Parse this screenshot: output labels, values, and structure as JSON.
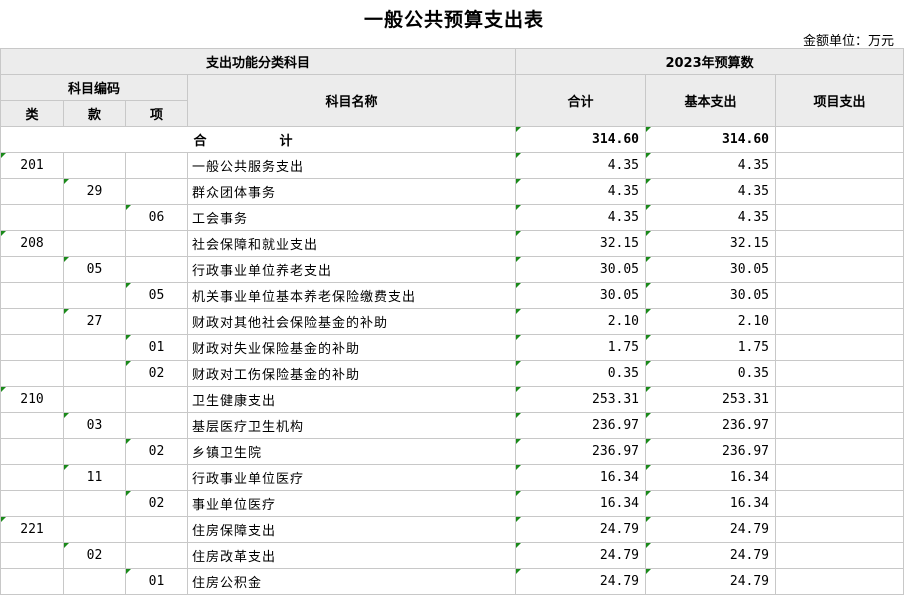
{
  "title": "一般公共预算支出表",
  "unit": "金额单位：万元",
  "header": {
    "group_left": "支出功能分类科目",
    "group_right": "2023年预算数",
    "code_group": "科目编码",
    "lei": "类",
    "kuan": "款",
    "xiang": "项",
    "name": "科目名称",
    "total": "合计",
    "basic": "基本支出",
    "project": "项目支出"
  },
  "total_row": {
    "label": "合　计",
    "total": "314.60",
    "basic": "314.60",
    "project": ""
  },
  "rows": [
    {
      "lei": "201",
      "kuan": "",
      "xiang": "",
      "name": "一般公共服务支出",
      "total": "4.35",
      "basic": "4.35",
      "project": ""
    },
    {
      "lei": "",
      "kuan": "29",
      "xiang": "",
      "name": "群众团体事务",
      "total": "4.35",
      "basic": "4.35",
      "project": ""
    },
    {
      "lei": "",
      "kuan": "",
      "xiang": "06",
      "name": "工会事务",
      "total": "4.35",
      "basic": "4.35",
      "project": ""
    },
    {
      "lei": "208",
      "kuan": "",
      "xiang": "",
      "name": "社会保障和就业支出",
      "total": "32.15",
      "basic": "32.15",
      "project": ""
    },
    {
      "lei": "",
      "kuan": "05",
      "xiang": "",
      "name": "行政事业单位养老支出",
      "total": "30.05",
      "basic": "30.05",
      "project": ""
    },
    {
      "lei": "",
      "kuan": "",
      "xiang": "05",
      "name": "机关事业单位基本养老保险缴费支出",
      "total": "30.05",
      "basic": "30.05",
      "project": ""
    },
    {
      "lei": "",
      "kuan": "27",
      "xiang": "",
      "name": "财政对其他社会保险基金的补助",
      "total": "2.10",
      "basic": "2.10",
      "project": ""
    },
    {
      "lei": "",
      "kuan": "",
      "xiang": "01",
      "name": "财政对失业保险基金的补助",
      "total": "1.75",
      "basic": "1.75",
      "project": ""
    },
    {
      "lei": "",
      "kuan": "",
      "xiang": "02",
      "name": "财政对工伤保险基金的补助",
      "total": "0.35",
      "basic": "0.35",
      "project": ""
    },
    {
      "lei": "210",
      "kuan": "",
      "xiang": "",
      "name": "卫生健康支出",
      "total": "253.31",
      "basic": "253.31",
      "project": ""
    },
    {
      "lei": "",
      "kuan": "03",
      "xiang": "",
      "name": "基层医疗卫生机构",
      "total": "236.97",
      "basic": "236.97",
      "project": ""
    },
    {
      "lei": "",
      "kuan": "",
      "xiang": "02",
      "name": "乡镇卫生院",
      "total": "236.97",
      "basic": "236.97",
      "project": ""
    },
    {
      "lei": "",
      "kuan": "11",
      "xiang": "",
      "name": "行政事业单位医疗",
      "total": "16.34",
      "basic": "16.34",
      "project": ""
    },
    {
      "lei": "",
      "kuan": "",
      "xiang": "02",
      "name": "事业单位医疗",
      "total": "16.34",
      "basic": "16.34",
      "project": ""
    },
    {
      "lei": "221",
      "kuan": "",
      "xiang": "",
      "name": "住房保障支出",
      "total": "24.79",
      "basic": "24.79",
      "project": ""
    },
    {
      "lei": "",
      "kuan": "02",
      "xiang": "",
      "name": "住房改革支出",
      "total": "24.79",
      "basic": "24.79",
      "project": ""
    },
    {
      "lei": "",
      "kuan": "",
      "xiang": "01",
      "name": "住房公积金",
      "total": "24.79",
      "basic": "24.79",
      "project": ""
    }
  ]
}
